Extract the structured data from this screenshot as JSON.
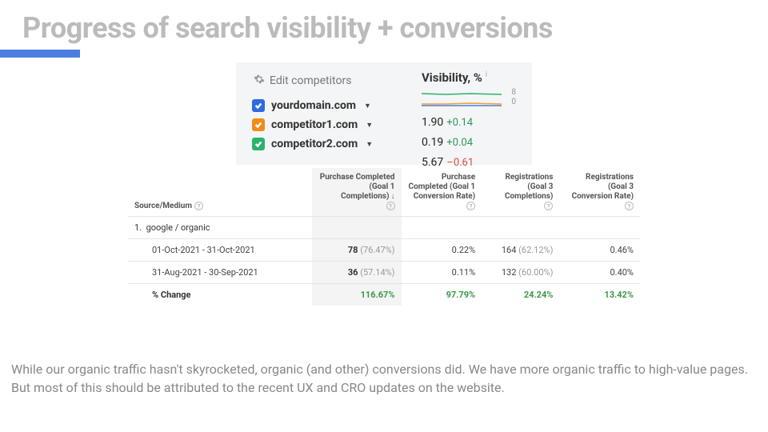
{
  "title": "Progress of search visibility + conversions",
  "visibility": {
    "edit_label": "Edit competitors",
    "col_title": "Visibility, %",
    "spark_labels": {
      "top": "8",
      "bottom": "0"
    },
    "rows": [
      {
        "domain": "yourdomain.com",
        "value": "1.90",
        "delta": "+0.14",
        "dir": "pos"
      },
      {
        "domain": "competitor1.com",
        "value": "0.19",
        "delta": "+0.04",
        "dir": "pos"
      },
      {
        "domain": "competitor2.com",
        "value": "5.67",
        "delta": "–0.61",
        "dir": "neg"
      }
    ]
  },
  "table": {
    "headers": {
      "source": "Source/Medium",
      "c1": "Purchase Completed (Goal 1 Completions)",
      "c2": "Purchase Completed (Goal 1 Conversion Rate)",
      "c3": "Registrations (Goal 3 Completions)",
      "c4": "Registrations (Goal 3 Conversion Rate)"
    },
    "group_label": "google / organic",
    "group_index": "1.",
    "rows": [
      {
        "range": "01-Oct-2021 - 31-Oct-2021",
        "c1": "78",
        "c1p": "(76.47%)",
        "c2": "0.22%",
        "c3": "164",
        "c3p": "(62.12%)",
        "c4": "0.46%"
      },
      {
        "range": "31-Aug-2021 - 30-Sep-2021",
        "c1": "36",
        "c1p": "(57.14%)",
        "c2": "0.11%",
        "c3": "132",
        "c3p": "(60.00%)",
        "c4": "0.40%"
      }
    ],
    "change": {
      "label": "% Change",
      "c1": "116.67%",
      "c2": "97.79%",
      "c3": "24.24%",
      "c4": "13.42%"
    }
  },
  "body_text": "While our organic traffic hasn't skyrocketed, organic (and other) conversions did. We have more organic traffic to high-value pages. But most of this should be attributed to the recent UX and CRO updates on the website.",
  "chart_data": {
    "type": "line",
    "title": "Visibility, %",
    "ylim": [
      0,
      8
    ],
    "series": [
      {
        "name": "yourdomain.com",
        "color": "#2e6ae0",
        "values_approx": [
          1.8,
          1.9,
          1.9,
          1.9
        ]
      },
      {
        "name": "competitor1.com",
        "color": "#f08c1a",
        "values_approx": [
          0.15,
          0.18,
          0.2,
          0.19
        ]
      },
      {
        "name": "competitor2.com",
        "color": "#2bb36a",
        "values_approx": [
          6.2,
          6.0,
          5.8,
          5.67
        ]
      }
    ]
  }
}
